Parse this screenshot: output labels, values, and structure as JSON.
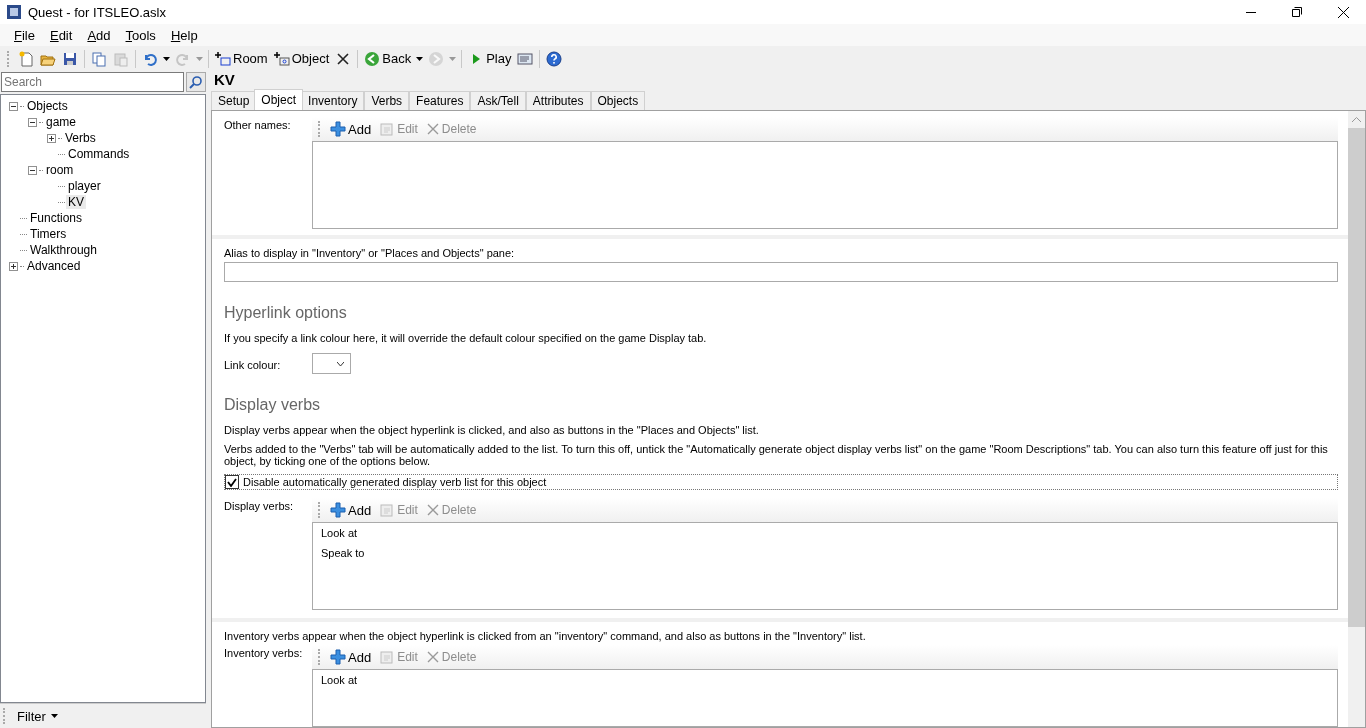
{
  "window": {
    "title": "Quest - for ITSLEO.aslx"
  },
  "menu": [
    {
      "label": "File"
    },
    {
      "label": "Edit"
    },
    {
      "label": "Add"
    },
    {
      "label": "Tools"
    },
    {
      "label": "Help"
    }
  ],
  "toolbar": {
    "groups": [
      [
        {
          "kind": "new",
          "disabled": false
        },
        {
          "kind": "open",
          "disabled": false
        },
        {
          "kind": "save",
          "disabled": false
        }
      ],
      [
        {
          "kind": "copy",
          "disabled": false
        },
        {
          "kind": "paste",
          "disabled": true
        }
      ],
      [
        {
          "kind": "undo",
          "disabled": false
        },
        {
          "kind": "dropdown",
          "disabled": false
        },
        {
          "kind": "redo",
          "disabled": true
        },
        {
          "kind": "dropdown",
          "disabled": true
        }
      ],
      [
        {
          "kind": "add-room",
          "label": "Room",
          "disabled": false
        },
        {
          "kind": "add-object",
          "label": "Object",
          "disabled": false
        },
        {
          "kind": "delete",
          "disabled": false
        }
      ],
      [
        {
          "kind": "back",
          "label": "Back",
          "disabled": false
        },
        {
          "kind": "dropdown",
          "disabled": false
        },
        {
          "kind": "forward",
          "disabled": true
        },
        {
          "kind": "dropdown",
          "disabled": true
        }
      ],
      [
        {
          "kind": "play",
          "label": "Play",
          "disabled": false
        },
        {
          "kind": "log",
          "disabled": false
        }
      ],
      [
        {
          "kind": "help",
          "disabled": false
        }
      ]
    ]
  },
  "search": {
    "placeholder": "Search"
  },
  "tree": [
    {
      "label": "Objects",
      "expanded": true,
      "selected": false,
      "children": [
        {
          "label": "game",
          "expanded": true,
          "selected": false,
          "children": [
            {
              "label": "Verbs",
              "expanded": false,
              "selected": false
            },
            {
              "label": "Commands",
              "selected": false
            }
          ]
        },
        {
          "label": "room",
          "expanded": true,
          "selected": false,
          "children": [
            {
              "label": "player",
              "selected": false
            },
            {
              "label": "KV",
              "selected": true
            }
          ]
        }
      ]
    },
    {
      "label": "Functions",
      "selected": false
    },
    {
      "label": "Timers",
      "selected": false
    },
    {
      "label": "Walkthrough",
      "selected": false
    },
    {
      "label": "Advanced",
      "expanded": false,
      "selected": false
    }
  ],
  "filter": {
    "label": "Filter"
  },
  "heading": "KV",
  "tabs": [
    {
      "label": "Setup",
      "selected": false
    },
    {
      "label": "Object",
      "selected": true
    },
    {
      "label": "Inventory",
      "selected": false
    },
    {
      "label": "Verbs",
      "selected": false
    },
    {
      "label": "Features",
      "selected": false
    },
    {
      "label": "Ask/Tell",
      "selected": false
    },
    {
      "label": "Attributes",
      "selected": false
    },
    {
      "label": "Objects",
      "selected": false
    }
  ],
  "sections": [
    {
      "kind": "list",
      "label": "Other names:",
      "actions": [
        {
          "label": "Add",
          "disabled": false
        },
        {
          "label": "Edit",
          "disabled": true
        },
        {
          "label": "Delete",
          "disabled": true
        }
      ]
    },
    {
      "kind": "text",
      "label": "Alias to display in \"Inventory\" or \"Places and Objects\" pane:"
    },
    {
      "kind": "heading",
      "text": "Hyperlink options"
    },
    {
      "kind": "note",
      "text": "If you specify a link colour here, it will override the default colour specified on the game Display tab."
    },
    {
      "kind": "combo",
      "label": "Link colour:"
    },
    {
      "kind": "heading",
      "text": "Display verbs"
    },
    {
      "kind": "note",
      "text": "Display verbs appear when the object hyperlink is clicked, and also as buttons in the \"Places and Objects\" list."
    },
    {
      "kind": "note",
      "text": "Verbs added to the \"Verbs\" tab will be automatically added to the list. To turn this off, untick the \"Automatically generate object display verbs list\" on the game \"Room Descriptions\" tab. You can also turn this feature off just for this object, by ticking one of the options below."
    },
    {
      "kind": "check",
      "label": "Disable automatically generated display verb list for this object",
      "checked": true
    },
    {
      "kind": "list",
      "label": "Display verbs:",
      "actions": [
        {
          "label": "Add",
          "disabled": false
        },
        {
          "label": "Edit",
          "disabled": true
        },
        {
          "label": "Delete",
          "disabled": true
        }
      ],
      "items": [
        "Look at",
        "Speak to"
      ]
    },
    {
      "kind": "note",
      "text": "Inventory verbs appear when the object hyperlink is clicked from an \"inventory\" command, and also as buttons in the \"Inventory\" list."
    },
    {
      "kind": "list",
      "label": "Inventory verbs:",
      "actions": [
        {
          "label": "Add",
          "disabled": false
        },
        {
          "label": "Edit",
          "disabled": true
        },
        {
          "label": "Delete",
          "disabled": true
        }
      ],
      "items": [
        "Look at"
      ]
    }
  ]
}
